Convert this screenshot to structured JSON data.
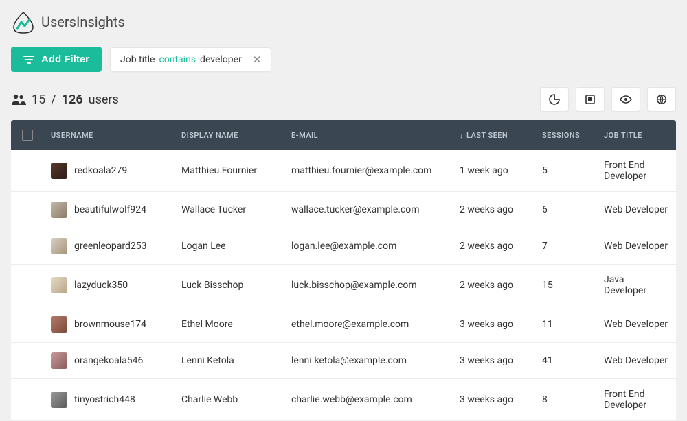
{
  "brand": "UsersInsights",
  "add_filter_label": "Add Filter",
  "filter": {
    "field": "Job title",
    "operator": "contains",
    "value": "developer"
  },
  "counts": {
    "shown": "15",
    "sep": "/",
    "total": "126",
    "label": "users"
  },
  "columns": {
    "username": "USERNAME",
    "display_name": "DISPLAY NAME",
    "email": "E-MAIL",
    "last_seen": "LAST SEEN",
    "sessions": "SESSIONS",
    "job_title": "JOB TITLE"
  },
  "sort_indicator": "↓",
  "rows": [
    {
      "username": "redkoala279",
      "display_name": "Matthieu Fournier",
      "email": "matthieu.fournier@example.com",
      "last_seen": "1 week ago",
      "sessions": "5",
      "job_title": "Front End Developer"
    },
    {
      "username": "beautifulwolf924",
      "display_name": "Wallace Tucker",
      "email": "wallace.tucker@example.com",
      "last_seen": "2 weeks ago",
      "sessions": "6",
      "job_title": "Web Developer"
    },
    {
      "username": "greenleopard253",
      "display_name": "Logan Lee",
      "email": "logan.lee@example.com",
      "last_seen": "2 weeks ago",
      "sessions": "7",
      "job_title": "Web Developer"
    },
    {
      "username": "lazyduck350",
      "display_name": "Luck Bisschop",
      "email": "luck.bisschop@example.com",
      "last_seen": "2 weeks ago",
      "sessions": "15",
      "job_title": "Java Developer"
    },
    {
      "username": "brownmouse174",
      "display_name": "Ethel Moore",
      "email": "ethel.moore@example.com",
      "last_seen": "3 weeks ago",
      "sessions": "11",
      "job_title": "Web Developer"
    },
    {
      "username": "orangekoala546",
      "display_name": "Lenni Ketola",
      "email": "lenni.ketola@example.com",
      "last_seen": "3 weeks ago",
      "sessions": "41",
      "job_title": "Web Developer"
    },
    {
      "username": "tinyostrich448",
      "display_name": "Charlie Webb",
      "email": "charlie.webb@example.com",
      "last_seen": "3 weeks ago",
      "sessions": "8",
      "job_title": "Front End Developer"
    }
  ]
}
